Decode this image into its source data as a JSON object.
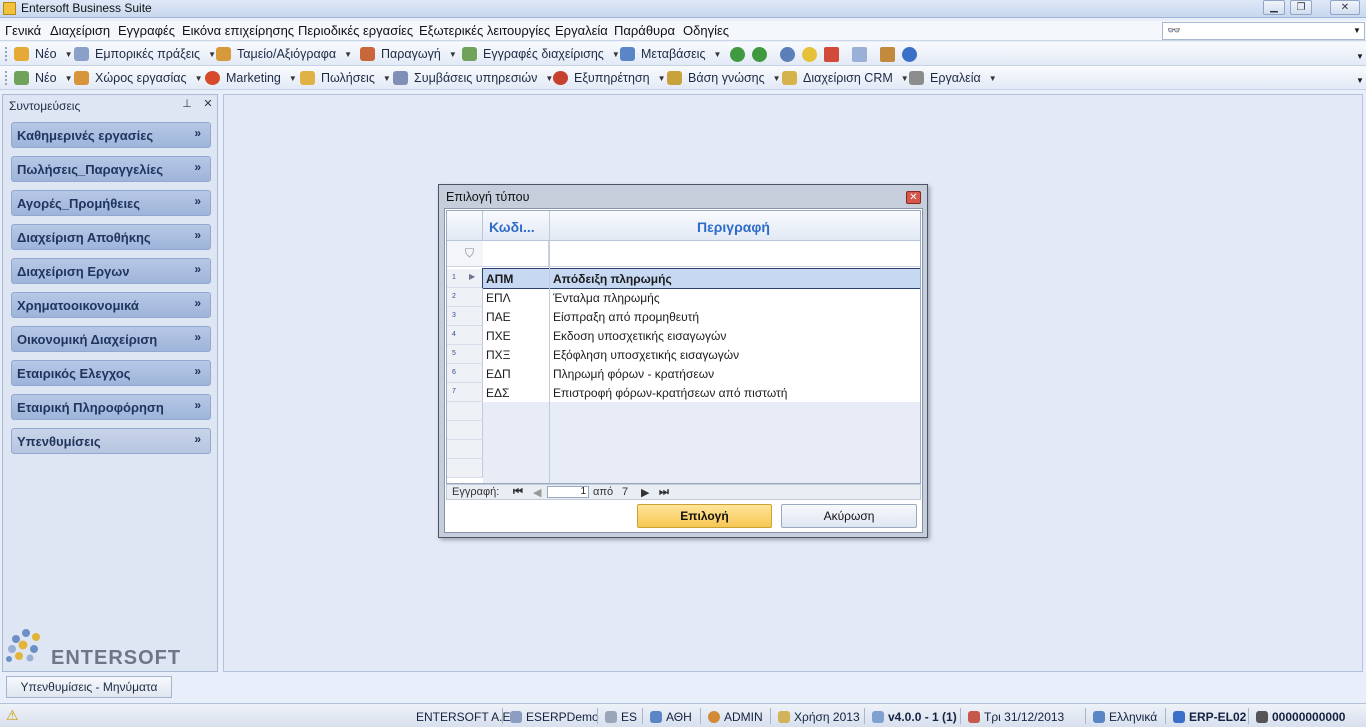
{
  "window": {
    "title": "Entersoft Business Suite",
    "min_icon": "minimize-icon",
    "max_icon": "maximize-icon",
    "close_icon": "close-icon"
  },
  "menu": [
    "Γενικά",
    "Διαχείριση",
    "Εγγραφές",
    "Εικόνα επιχείρησης",
    "Περιοδικές εργασίες",
    "Εξωτερικές λειτουργίες",
    "Εργαλεία",
    "Παράθυρα",
    "Οδηγίες"
  ],
  "toolbar1": [
    {
      "label": "Νέο",
      "color": "#e5a935"
    },
    {
      "label": "Εμπορικές πράξεις",
      "color": "#8aa0c8"
    },
    {
      "label": "Ταμείο/Αξιόγραφα",
      "color": "#d69a3c"
    },
    {
      "label": "Παραγωγή",
      "color": "#c8683a"
    },
    {
      "label": "Εγγραφές διαχείρισης",
      "color": "#6fa35a"
    },
    {
      "label": "Μεταβάσεις",
      "color": "#5a86c8"
    }
  ],
  "toolbar2": [
    {
      "label": "Νέο",
      "color": "#6fa35a"
    },
    {
      "label": "Χώρος εργασίας",
      "color": "#d6953a"
    },
    {
      "label": "Marketing",
      "color": "#d64a2a"
    },
    {
      "label": "Πωλήσεις",
      "color": "#e0b245"
    },
    {
      "label": "Συμβάσεις υπηρεσιών",
      "color": "#7f8fb5"
    },
    {
      "label": "Εξυπηρέτηση",
      "color": "#c8402e"
    },
    {
      "label": "Βάση γνώσης",
      "color": "#caa23c"
    },
    {
      "label": "Διαχείριση CRM",
      "color": "#d6b24a"
    },
    {
      "label": "Εργαλεία",
      "color": "#8c8c8c"
    }
  ],
  "sidebar": {
    "title": "Συντομεύσεις",
    "groups": [
      "Καθημερινές εργασίες",
      "Πωλήσεις_Παραγγελίες",
      "Αγορές_Προμήθειες",
      "Διαχείριση Αποθήκης",
      "Διαχείριση Εργων",
      "Χρηματοοικονομικά",
      "Οικονομική Διαχείριση",
      "Εταιρικός Ελεγχος",
      "Εταιρική Πληροφόρηση",
      "Υπενθυμίσεις"
    ],
    "logo_text": "ENTERSOFT",
    "bottom_tab": "Υπενθυμίσεις - Μηνύματα"
  },
  "dialog": {
    "title": "Επιλογή τύπου",
    "col_code": "Κωδι...",
    "col_desc": "Περιγραφή",
    "rows": [
      {
        "n": "1",
        "code": "ΑΠΜ",
        "desc": "Απόδειξη πληρωμής"
      },
      {
        "n": "2",
        "code": "ΕΠΛ",
        "desc": "Ένταλμα πληρωμής"
      },
      {
        "n": "3",
        "code": "ΠΑΕ",
        "desc": "Είσπραξη από προμηθευτή"
      },
      {
        "n": "4",
        "code": "ΠΧΕ",
        "desc": "Εκδοση υποσχετικής εισαγωγών"
      },
      {
        "n": "5",
        "code": "ΠΧΞ",
        "desc": "Εξόφληση υποσχετικής εισαγωγών"
      },
      {
        "n": "6",
        "code": "ΕΔΠ",
        "desc": "Πληρωμή φόρων - κρατήσεων"
      },
      {
        "n": "7",
        "code": "ΕΔΣ",
        "desc": "Επιστροφή φόρων-κρατήσεων από πιστωτή"
      }
    ],
    "nav": {
      "label": "Εγγραφή:",
      "current": "1",
      "of": "από",
      "total": "7"
    },
    "btn_select": "Επιλογή",
    "btn_cancel": "Ακύρωση"
  },
  "status": {
    "company": "ENTERSOFT A.E.",
    "db": "ESERPDemo",
    "lang_code": "ES",
    "branch": "ΑΘΗ",
    "user": "ADMIN",
    "period": "Χρήση 2013",
    "version": "v4.0.0 - 1 (1)",
    "date": "Τρι 31/12/2013",
    "language": "Ελληνικά",
    "server": "ERP-EL02",
    "serial": "00000000000"
  }
}
